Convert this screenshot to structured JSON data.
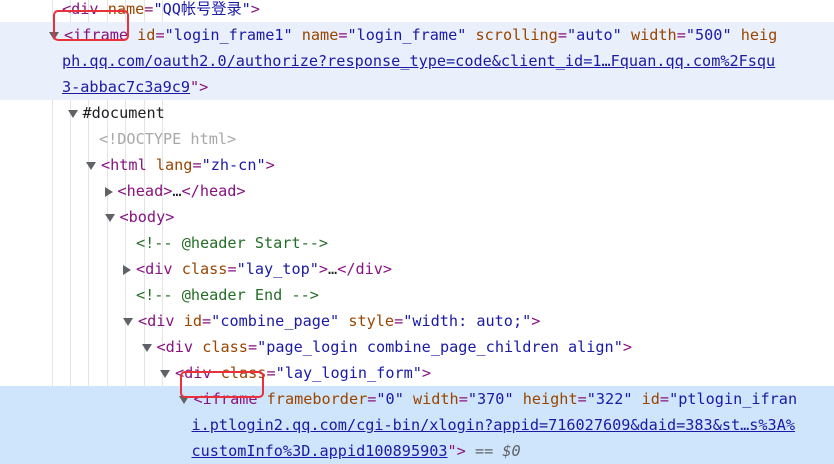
{
  "lines": [
    {
      "indent": 0,
      "mark": "none",
      "sel": "",
      "parts": [
        {
          "c": "tag",
          "t": "<div "
        },
        {
          "c": "attr",
          "t": "name"
        },
        {
          "c": "tag",
          "t": "="
        },
        {
          "c": "val",
          "t": "\"QQ帐号登录\""
        },
        {
          "c": "tag",
          "t": ">"
        }
      ]
    },
    {
      "indent": 0,
      "mark": "down",
      "sel": "sel",
      "parts": [
        {
          "c": "tag",
          "t": "<iframe "
        },
        {
          "c": "attr",
          "t": "id"
        },
        {
          "c": "tag",
          "t": "="
        },
        {
          "c": "val",
          "t": "\"login_frame1\""
        },
        {
          "c": "attr",
          "t": " name"
        },
        {
          "c": "tag",
          "t": "="
        },
        {
          "c": "val",
          "t": "\"login_frame\""
        },
        {
          "c": "attr",
          "t": " scrolling"
        },
        {
          "c": "tag",
          "t": "="
        },
        {
          "c": "val",
          "t": "\"auto\""
        },
        {
          "c": "attr",
          "t": " width"
        },
        {
          "c": "tag",
          "t": "="
        },
        {
          "c": "val",
          "t": "\"500\""
        },
        {
          "c": "attr",
          "t": " heig"
        }
      ]
    },
    {
      "indent": 0,
      "mark": "none",
      "sel": "sel",
      "parts": [
        {
          "c": "link",
          "t": "ph.qq.com/oauth2.0/authorize?response_type=code&client_id=1…Fquan.qq.com%2Fsqu"
        }
      ]
    },
    {
      "indent": 0,
      "mark": "none",
      "sel": "sel",
      "parts": [
        {
          "c": "link",
          "t": "3-abbac7c3a9c9"
        },
        {
          "c": "tag",
          "t": "\">"
        }
      ]
    },
    {
      "indent": 1,
      "mark": "down",
      "sel": "",
      "parts": [
        {
          "c": "txt",
          "t": "#document"
        }
      ]
    },
    {
      "indent": 2,
      "mark": "none",
      "sel": "",
      "parts": [
        {
          "c": "doc",
          "t": "<!DOCTYPE html>"
        }
      ]
    },
    {
      "indent": 2,
      "mark": "down",
      "sel": "",
      "parts": [
        {
          "c": "tag",
          "t": "<html "
        },
        {
          "c": "attr",
          "t": "lang"
        },
        {
          "c": "tag",
          "t": "="
        },
        {
          "c": "val",
          "t": "\"zh-cn\""
        },
        {
          "c": "tag",
          "t": ">"
        }
      ]
    },
    {
      "indent": 3,
      "mark": "right",
      "sel": "",
      "parts": [
        {
          "c": "tag",
          "t": "<head>"
        },
        {
          "c": "txt",
          "t": "…"
        },
        {
          "c": "tag",
          "t": "</head>"
        }
      ]
    },
    {
      "indent": 3,
      "mark": "down",
      "sel": "",
      "parts": [
        {
          "c": "tag",
          "t": "<body>"
        }
      ]
    },
    {
      "indent": 4,
      "mark": "none",
      "sel": "",
      "parts": [
        {
          "c": "com",
          "t": "<!-- @header Start-->"
        }
      ]
    },
    {
      "indent": 4,
      "mark": "right",
      "sel": "",
      "parts": [
        {
          "c": "tag",
          "t": "<div "
        },
        {
          "c": "attr",
          "t": "class"
        },
        {
          "c": "tag",
          "t": "="
        },
        {
          "c": "val",
          "t": "\"lay_top\""
        },
        {
          "c": "tag",
          "t": ">"
        },
        {
          "c": "txt",
          "t": "…"
        },
        {
          "c": "tag",
          "t": "</div>"
        }
      ]
    },
    {
      "indent": 4,
      "mark": "none",
      "sel": "",
      "parts": [
        {
          "c": "com",
          "t": "<!-- @header End -->"
        }
      ]
    },
    {
      "indent": 4,
      "mark": "down",
      "sel": "",
      "parts": [
        {
          "c": "tag",
          "t": "<div "
        },
        {
          "c": "attr",
          "t": "id"
        },
        {
          "c": "tag",
          "t": "="
        },
        {
          "c": "val",
          "t": "\"combine_page\""
        },
        {
          "c": "attr",
          "t": " style"
        },
        {
          "c": "tag",
          "t": "="
        },
        {
          "c": "val",
          "t": "\"width: auto;\""
        },
        {
          "c": "tag",
          "t": ">"
        }
      ]
    },
    {
      "indent": 5,
      "mark": "down",
      "sel": "",
      "parts": [
        {
          "c": "tag",
          "t": "<div "
        },
        {
          "c": "attr",
          "t": "class"
        },
        {
          "c": "tag",
          "t": "="
        },
        {
          "c": "val",
          "t": "\"page_login combine_page_children align\""
        },
        {
          "c": "tag",
          "t": ">"
        }
      ]
    },
    {
      "indent": 6,
      "mark": "down",
      "sel": "",
      "parts": [
        {
          "c": "tag",
          "t": "<div "
        },
        {
          "c": "attr",
          "t": "class"
        },
        {
          "c": "tag",
          "t": "="
        },
        {
          "c": "val",
          "t": "\"lay_login_form\""
        },
        {
          "c": "tag",
          "t": ">"
        }
      ]
    },
    {
      "indent": 7,
      "mark": "down",
      "sel": "sel2",
      "parts": [
        {
          "c": "tag",
          "t": "<iframe "
        },
        {
          "c": "attr",
          "t": "frameborder"
        },
        {
          "c": "tag",
          "t": "="
        },
        {
          "c": "val",
          "t": "\"0\""
        },
        {
          "c": "attr",
          "t": " width"
        },
        {
          "c": "tag",
          "t": "="
        },
        {
          "c": "val",
          "t": "\"370\""
        },
        {
          "c": "attr",
          "t": " height"
        },
        {
          "c": "tag",
          "t": "="
        },
        {
          "c": "val",
          "t": "\"322\""
        },
        {
          "c": "attr",
          "t": " id"
        },
        {
          "c": "tag",
          "t": "="
        },
        {
          "c": "val",
          "t": "\"ptlogin_ifran"
        }
      ]
    },
    {
      "indent": 7,
      "mark": "none",
      "sel": "sel2",
      "parts": [
        {
          "c": "link",
          "t": "i.ptlogin2.qq.com/cgi-bin/xlogin?appid=716027609&daid=383&st…s%3A%"
        }
      ]
    },
    {
      "indent": 7,
      "mark": "none",
      "sel": "sel2",
      "parts": [
        {
          "c": "link",
          "t": "customInfo%3D.appid100895903"
        },
        {
          "c": "tag",
          "t": "\">"
        },
        {
          "c": "eq",
          "t": " == $0"
        }
      ]
    }
  ]
}
